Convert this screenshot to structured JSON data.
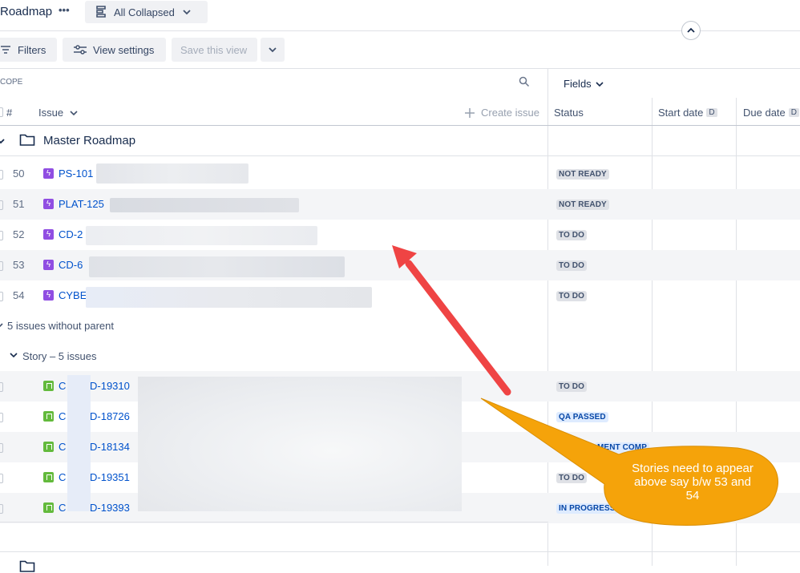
{
  "header": {
    "title": "Roadmap",
    "more_label": "•••",
    "view_selector": "All Collapsed"
  },
  "toolbar": {
    "filters": "Filters",
    "view_settings": "View settings",
    "save_view": "Save this view"
  },
  "scope": {
    "label": "COPE",
    "fields_label": "Fields"
  },
  "columns": {
    "num": "#",
    "issue": "Issue",
    "create_issue": "Create issue",
    "status": "Status",
    "start_date": "Start date",
    "due_date": "Due date",
    "date_badge": "D"
  },
  "group": {
    "title": "Master Roadmap"
  },
  "epics": [
    {
      "num": "50",
      "key": "PS-101",
      "status": "NOT READY"
    },
    {
      "num": "51",
      "key": "PLAT-125",
      "status": "NOT READY"
    },
    {
      "num": "52",
      "key": "CD-2",
      "status": "TO DO"
    },
    {
      "num": "53",
      "key": "CD-6",
      "status": "TO DO"
    },
    {
      "num": "54",
      "key": "CYBEF",
      "status": "TO DO"
    }
  ],
  "without_parent": "5 issues without parent",
  "story_group": "Story – 5 issues",
  "stories": [
    {
      "key_a": "C",
      "key_b": "D-19310",
      "status": "TO DO"
    },
    {
      "key_a": "C",
      "key_b": "D-18726",
      "status": "QA PASSED"
    },
    {
      "key_a": "C",
      "key_b": "D-18134",
      "status": "MENT COMP"
    },
    {
      "key_a": "C",
      "key_b": "D-19351",
      "status": "TO DO"
    },
    {
      "key_a": "C",
      "key_b": "D-19393",
      "status": "IN PROGRESS"
    }
  ],
  "callout": {
    "text": "Stories need to appear above say b/w 53 and 54",
    "color": "#f5a30a"
  },
  "arrow_color": "#ef4444"
}
